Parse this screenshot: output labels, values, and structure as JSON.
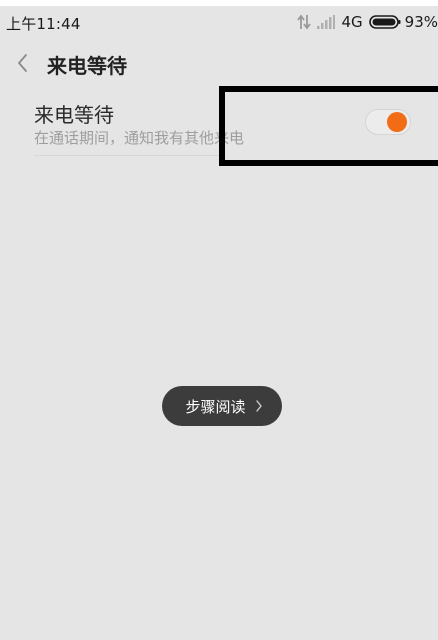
{
  "status_bar": {
    "time": "上午11:44",
    "network_type": "4G",
    "battery_percent": "93%",
    "icons": [
      "data-arrows-icon",
      "signal-icon",
      "battery-icon"
    ]
  },
  "header": {
    "back_icon": "chevron-left-icon",
    "title": "来电等待"
  },
  "setting": {
    "title": "来电等待",
    "description": "在通话期间，通知我有其他来电",
    "toggle_on": true
  },
  "step_button": {
    "label": "步骤阅读",
    "icon": "chevron-right-icon"
  },
  "colors": {
    "background": "#e5e5e5",
    "accent": "#f26c16",
    "step_button_bg": "#3c3c3c",
    "highlight_border": "#000000"
  }
}
